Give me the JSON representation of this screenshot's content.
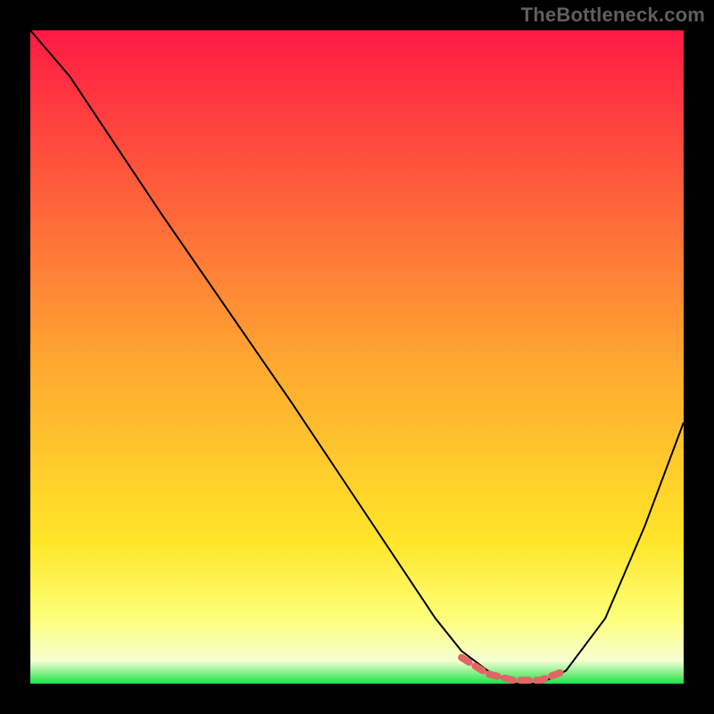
{
  "attribution": "TheBottleneck.com",
  "chart_data": {
    "type": "line",
    "title": "",
    "xlabel": "",
    "ylabel": "",
    "xlim": [
      0,
      100
    ],
    "ylim": [
      0,
      100
    ],
    "background_gradient": {
      "stops": [
        {
          "offset": 0.0,
          "color": "#ff1a44"
        },
        {
          "offset": 0.5,
          "color": "#ffa531"
        },
        {
          "offset": 0.78,
          "color": "#ffe528"
        },
        {
          "offset": 0.9,
          "color": "#fdff7a"
        },
        {
          "offset": 0.965,
          "color": "#f6ffd2"
        },
        {
          "offset": 1.0,
          "color": "#1fe248"
        }
      ]
    },
    "series": [
      {
        "name": "bottleneck-curve",
        "color": "#000000",
        "x": [
          0,
          6,
          12,
          20,
          30,
          40,
          50,
          58,
          62,
          66,
          70,
          74,
          78,
          82,
          88,
          94,
          100
        ],
        "y": [
          100,
          93,
          84,
          72,
          57.5,
          43,
          28,
          16,
          10,
          5,
          2,
          0,
          0,
          2,
          10,
          24,
          40
        ]
      },
      {
        "name": "optimal-band",
        "color": "#e06666",
        "style": "dashed-thick",
        "x": [
          66,
          70,
          74,
          78,
          82
        ],
        "y": [
          4,
          1.5,
          0.5,
          0.5,
          2
        ]
      }
    ],
    "annotations": []
  }
}
